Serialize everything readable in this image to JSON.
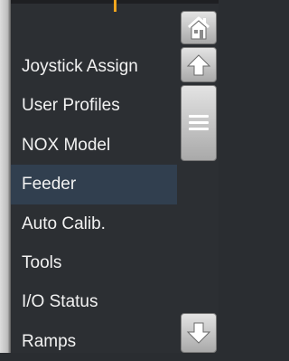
{
  "menu": {
    "items": [
      {
        "label": "Joystick Assign",
        "selected": false
      },
      {
        "label": "User Profiles",
        "selected": false
      },
      {
        "label": "NOX Model",
        "selected": false
      },
      {
        "label": "Feeder",
        "selected": true
      },
      {
        "label": "Auto Calib.",
        "selected": false
      },
      {
        "label": "Tools",
        "selected": false
      },
      {
        "label": "I/O Status",
        "selected": false
      },
      {
        "label": "Ramps",
        "selected": false
      }
    ]
  },
  "scrollbar": {
    "icons": [
      "home-icon",
      "arrow-up-icon",
      "drag-handle-icon",
      "arrow-down-icon"
    ]
  },
  "colors": {
    "background": "#2c2f33",
    "selected_row": "#313f4f",
    "text": "#f2f2f2",
    "button": "#c8c8c8",
    "accent": "#f0a51e"
  }
}
